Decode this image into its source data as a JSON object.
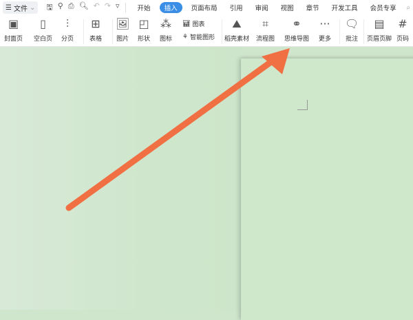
{
  "topbar": {
    "menu_label": "文件",
    "tabs": [
      "开始",
      "插入",
      "页面布局",
      "引用",
      "审阅",
      "视图",
      "章节",
      "开发工具",
      "会员专享"
    ],
    "active_tab": "插入"
  },
  "ribbon": {
    "cover": "封面页",
    "blank": "空白页",
    "pagebreak": "分页",
    "table": "表格",
    "picture": "图片",
    "shape": "形状",
    "icon": "图标",
    "chart": "图表",
    "smartart": "智能图形",
    "material": "稻壳素材",
    "flowchart": "流程图",
    "mindmap": "思维导图",
    "more": "更多",
    "comment": "批注",
    "header_footer": "页眉页脚",
    "page_number": "页码"
  },
  "annotation": {
    "arrow_color": "#f07043"
  }
}
